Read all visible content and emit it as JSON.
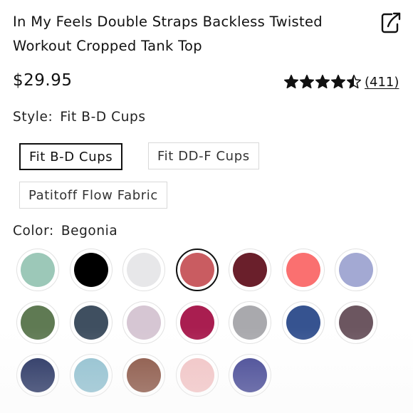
{
  "product": {
    "title_line1": "In My Feels Double Straps Backless Twisted",
    "title_line2": "Workout Cropped Tank Top",
    "price": "$29.95",
    "rating_value": 4.5,
    "review_count": "(411)",
    "share_icon": "share-icon"
  },
  "style": {
    "label": "Style:",
    "selected": "Fit B-D Cups",
    "options": [
      "Fit B-D Cups",
      "Fit DD-F Cups",
      "Patitoff Flow Fabric"
    ]
  },
  "color": {
    "label": "Color:",
    "selected": "Begonia",
    "swatches": [
      "#9cc8b8",
      "#000000",
      "#e7e7e9",
      "#c95c61",
      "#6a1f2b",
      "#fa7070",
      "#a3a9d3",
      "#5f7a53",
      "#3f4f60",
      "#d6c6d3",
      "#a91e50",
      "#a9a9ad",
      "#365390",
      "#6c5660",
      "#1e2b5b",
      "#8fbfcf",
      "#87503f",
      "#f2c3c4",
      "#3f4291"
    ],
    "selected_index": 3
  },
  "colors": {
    "text": "#111111",
    "border": "#d9d9d9",
    "selected_border": "#111111",
    "star": "#111111"
  }
}
